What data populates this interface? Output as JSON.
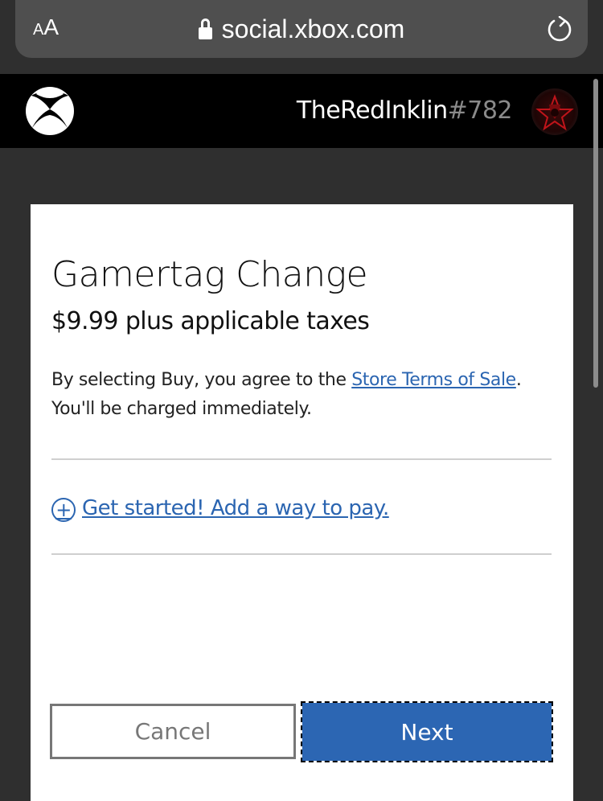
{
  "browser": {
    "text_size_small": "A",
    "text_size_big": "A",
    "url": "social.xbox.com",
    "lock_icon": "lock-icon",
    "reload_icon": "reload-icon"
  },
  "header": {
    "logo_icon": "xbox-logo-icon",
    "gamertag": "TheRedInklin",
    "gamertag_suffix": "#782",
    "avatar_icon": "avatar-red-emblem"
  },
  "dialog": {
    "title": "Gamertag Change",
    "price": "$9.99 plus applicable taxes",
    "terms_prefix": "By selecting Buy, you agree to the ",
    "terms_link": "Store Terms of Sale",
    "terms_suffix": ".",
    "terms_line2": "You'll be charged immediately.",
    "add_payment_icon": "plus-circle-icon",
    "add_payment_label": "Get started! Add a way to pay.",
    "cancel_label": "Cancel",
    "next_label": "Next"
  },
  "colors": {
    "link": "#2b65b1",
    "primary_button": "#2c66b3",
    "header_bg": "#000000",
    "page_bg": "#2f2f2f"
  }
}
